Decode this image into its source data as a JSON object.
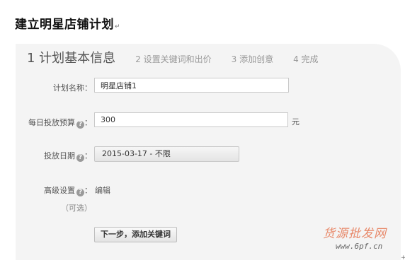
{
  "doc": {
    "title": "建立明星店铺计划",
    "paragraph_mark": "↵"
  },
  "steps": [
    {
      "label": "1 计划基本信息",
      "active": true
    },
    {
      "label": "2 设置关键词和出价",
      "active": false
    },
    {
      "label": "3 添加创意",
      "active": false
    },
    {
      "label": "4 完成",
      "active": false
    }
  ],
  "form": {
    "plan_name": {
      "label": "计划名称：",
      "value": "明星店铺1"
    },
    "daily_budget": {
      "label": "每日投放预算",
      "colon": "：",
      "value": "300",
      "unit": "元"
    },
    "dates": {
      "label": "投放日期",
      "colon": "：",
      "value": "2015-03-17 - 不限"
    },
    "advanced": {
      "label": "高级设置",
      "colon": "：",
      "link": "编辑",
      "optional": "（可选）"
    },
    "help_glyph": "?",
    "next_button": "下一步，添加关键词"
  },
  "watermark": {
    "text": "货源批发网",
    "url": "www.6pf.cn"
  }
}
